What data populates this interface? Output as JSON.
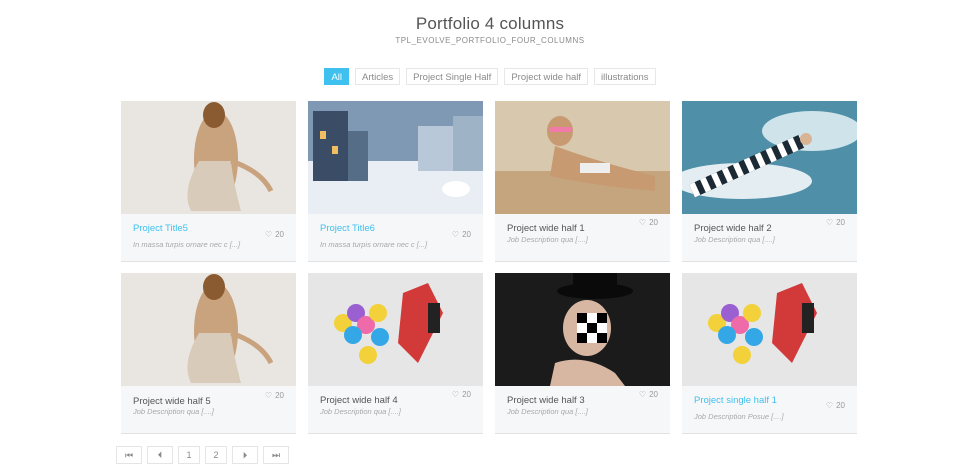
{
  "page": {
    "title": "Portfolio 4 columns",
    "subtitle": "TPL_EVOLVE_PORTFOLIO_FOUR_COLUMNS"
  },
  "filters": [
    "All",
    "Articles",
    "Project Single Half",
    "Project wide half",
    "illustrations"
  ],
  "active_filter": "All",
  "cards": [
    {
      "title": "Project Title5",
      "desc": "In massa turpis ornare nec c [...]",
      "likes": "20",
      "linked": true,
      "image": "woman-water-dress"
    },
    {
      "title": "Project Title6",
      "desc": "In massa turpis ornare nec c [...]",
      "likes": "20",
      "linked": true,
      "image": "winter-city-polar-bear"
    },
    {
      "title": "Project wide half 1",
      "desc": "Job Description     qua [....]",
      "likes": "20",
      "linked": false,
      "image": "woman-sunglasses-beach"
    },
    {
      "title": "Project wide half 2",
      "desc": "Job Description     qua [....]",
      "likes": "20",
      "linked": false,
      "image": "arm-sky-ribbon"
    },
    {
      "title": "Project wide half 5",
      "desc": "Job Description     qua [....]",
      "likes": "20",
      "linked": false,
      "image": "woman-water-dress"
    },
    {
      "title": "Project wide half 4",
      "desc": "Job Description     qua [....]",
      "likes": "20",
      "linked": false,
      "image": "man-balloons"
    },
    {
      "title": "Project wide half 3",
      "desc": "Job Description     qua [....]",
      "likes": "20",
      "linked": false,
      "image": "woman-top-hat"
    },
    {
      "title": "Project single half 1",
      "desc": "Job Description     Posue [....]",
      "likes": "20",
      "linked": true,
      "image": "man-balloons"
    }
  ],
  "pagination": {
    "first": "⏮",
    "prev": "⏴",
    "pages": [
      "1",
      "2"
    ],
    "next": "⏵",
    "last": "⏭"
  },
  "colors": {
    "accent": "#3fc1ef",
    "card_bg": "#f6f7f9"
  }
}
